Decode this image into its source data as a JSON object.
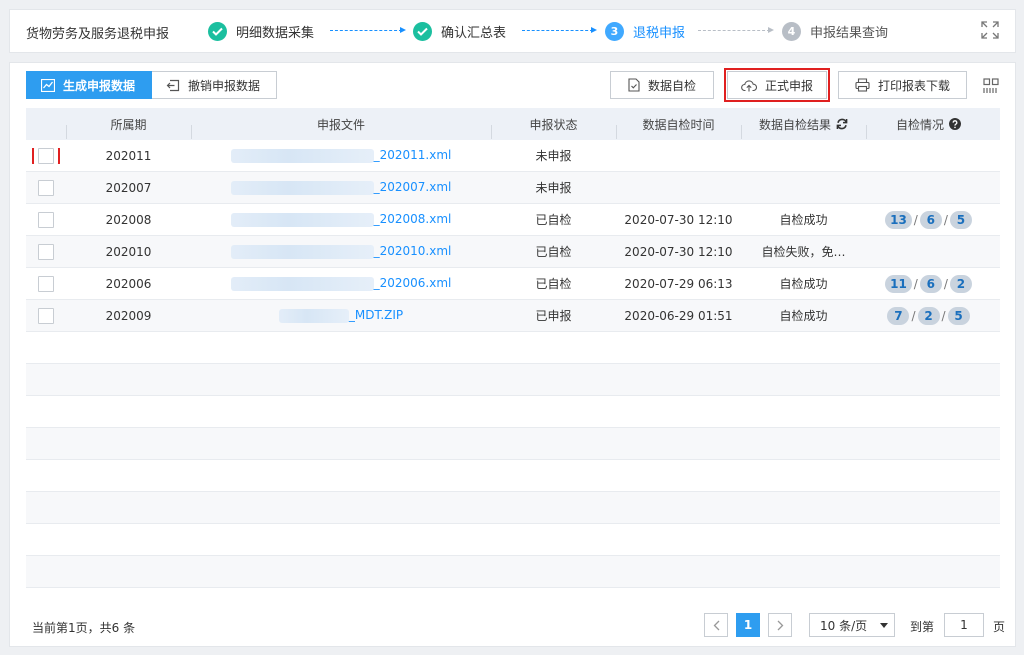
{
  "app": {
    "title": "货物劳务及服务退税申报"
  },
  "steps": [
    {
      "number": "1",
      "label": "明细数据采集",
      "state": "done"
    },
    {
      "number": "2",
      "label": "确认汇总表",
      "state": "done"
    },
    {
      "number": "3",
      "label": "退税申报",
      "state": "active"
    },
    {
      "number": "4",
      "label": "申报结果查询",
      "state": "todo"
    }
  ],
  "tabs": [
    {
      "label": "生成申报数据",
      "active": true
    },
    {
      "label": "撤销申报数据",
      "active": false
    }
  ],
  "toolbar": {
    "check_label": "数据自检",
    "submit_label": "正式申报",
    "print_label": "打印报表下载"
  },
  "table": {
    "headers": [
      "所属期",
      "申报文件",
      "申报状态",
      "数据自检时间",
      "数据自检结果",
      "自检情况"
    ],
    "rows": [
      {
        "period": "202011",
        "file": "_202011.xml",
        "status": "未申报",
        "time": "",
        "result": "",
        "counts": []
      },
      {
        "period": "202007",
        "file": "_202007.xml",
        "status": "未申报",
        "time": "",
        "result": "",
        "counts": []
      },
      {
        "period": "202008",
        "file": "_202008.xml",
        "status": "已自检",
        "time": "2020-07-30 12:10",
        "result": "自检成功",
        "counts": [
          "13",
          "6",
          "5"
        ]
      },
      {
        "period": "202010",
        "file": "_202010.xml",
        "status": "已自检",
        "time": "2020-07-30 12:10",
        "result": "自检失败，免…",
        "counts": []
      },
      {
        "period": "202006",
        "file": "_202006.xml",
        "status": "已自检",
        "time": "2020-07-29 06:13",
        "result": "自检成功",
        "counts": [
          "11",
          "6",
          "2"
        ]
      },
      {
        "period": "202009",
        "file": "_MDT.ZIP",
        "status": "已申报",
        "time": "2020-06-29 01:51",
        "result": "自检成功",
        "counts": [
          "7",
          "2",
          "5"
        ]
      }
    ]
  },
  "footer": {
    "info": "当前第1页，共6 条",
    "current_page": "1",
    "page_size": "10 条/页",
    "goto_prefix": "到第",
    "goto_value": "1",
    "goto_suffix": "页"
  },
  "colors": {
    "accent": "#2e9df0",
    "step_done": "#1bbf9f",
    "highlight": "#e02020"
  },
  "icons": {
    "tab_generate": "chart-icon",
    "tab_revoke": "undo-icon",
    "check": "document-check-icon",
    "submit": "upload-cloud-icon",
    "print": "printer-icon",
    "expand": "expand-icon",
    "grid": "grid-icon"
  }
}
